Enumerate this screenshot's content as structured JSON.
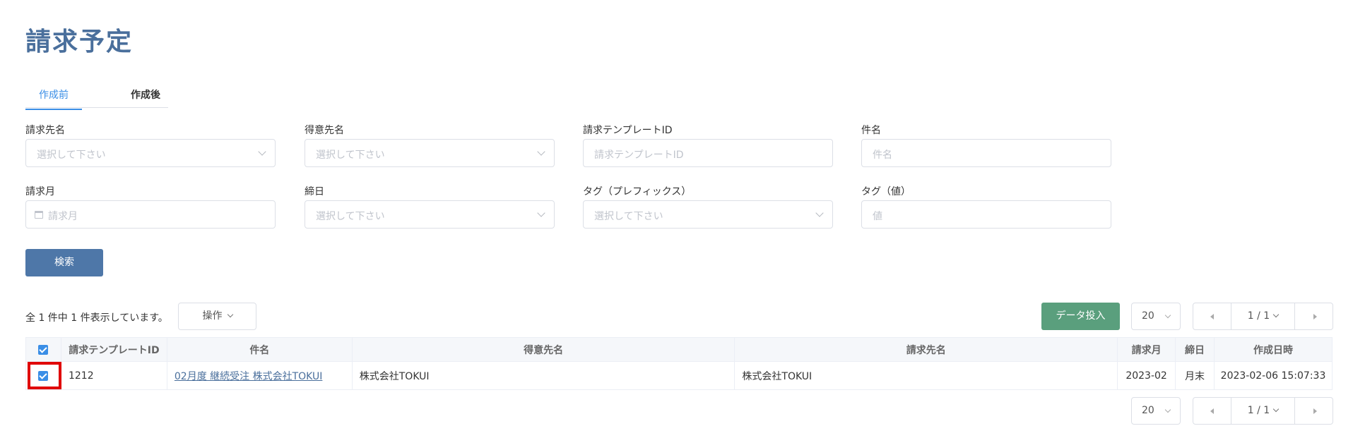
{
  "page_title": "請求予定",
  "tabs": [
    {
      "label": "作成前",
      "active": true
    },
    {
      "label": "作成後",
      "active": false
    }
  ],
  "filters": {
    "billing_target": {
      "label": "請求先名",
      "placeholder": "選択して下さい"
    },
    "customer": {
      "label": "得意先名",
      "placeholder": "選択して下さい"
    },
    "template_id": {
      "label": "請求テンプレートID",
      "placeholder": "請求テンプレートID"
    },
    "subject": {
      "label": "件名",
      "placeholder": "件名"
    },
    "billing_month": {
      "label": "請求月",
      "placeholder": "請求月"
    },
    "closing_day": {
      "label": "締日",
      "placeholder": "選択して下さい"
    },
    "tag_prefix": {
      "label": "タグ（プレフィックス）",
      "placeholder": "選択して下さい"
    },
    "tag_value": {
      "label": "タグ（値）",
      "placeholder": "値"
    }
  },
  "search_button": "検索",
  "result_count": "全 1 件中 1 件表示しています。",
  "operations_button": "操作",
  "import_button": "データ投入",
  "pagination": {
    "page_size": "20",
    "page": "1 / 1"
  },
  "table": {
    "headers": [
      "請求テンプレートID",
      "件名",
      "得意先名",
      "請求先名",
      "請求月",
      "締日",
      "作成日時"
    ],
    "rows": [
      {
        "checked": true,
        "template_id": "1212",
        "subject": "02月度 継続受注 株式会社TOKUI",
        "customer": "株式会社TOKUI",
        "billing_target": "株式会社TOKUI",
        "billing_month": "2023-02",
        "closing_day": "月末",
        "created_at": "2023-02-06 15:07:33"
      }
    ]
  },
  "colors": {
    "title": "#4a6f9c",
    "primary_button": "#4e77a8",
    "import_button": "#5a9f7d",
    "active_tab": "#3a8ee6",
    "highlight": "#e00000"
  }
}
